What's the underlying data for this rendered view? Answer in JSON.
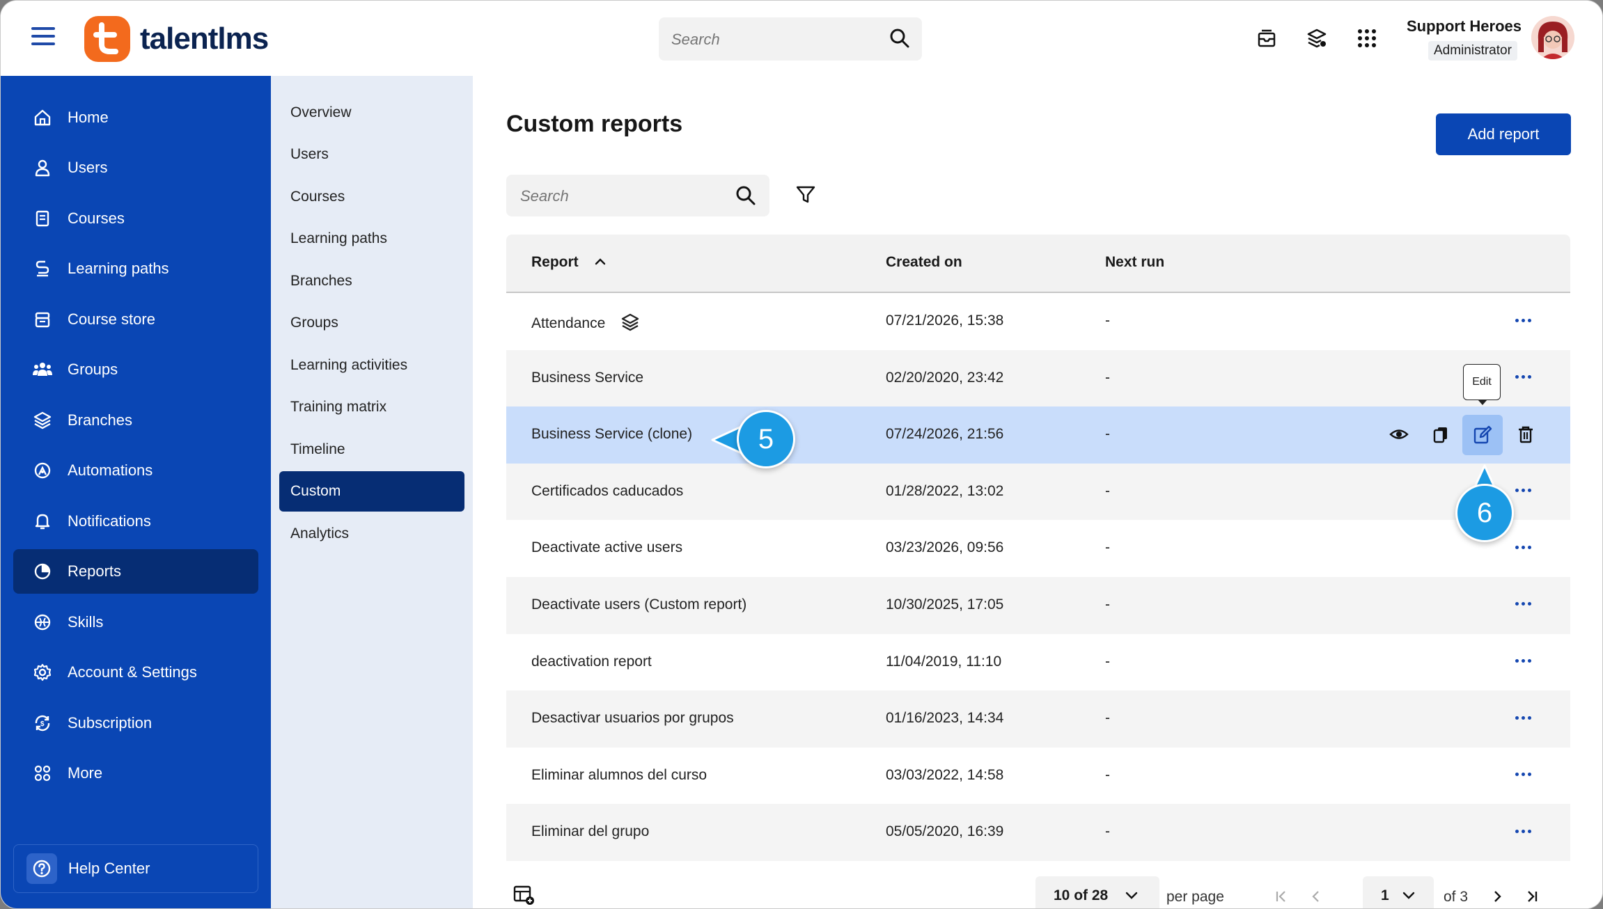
{
  "app": {
    "logo_text": "talentlms",
    "search_placeholder": "Search"
  },
  "user": {
    "name": "Support Heroes",
    "role": "Administrator"
  },
  "sidebar": {
    "items": [
      {
        "label": "Home"
      },
      {
        "label": "Users"
      },
      {
        "label": "Courses"
      },
      {
        "label": "Learning paths"
      },
      {
        "label": "Course store"
      },
      {
        "label": "Groups"
      },
      {
        "label": "Branches"
      },
      {
        "label": "Automations"
      },
      {
        "label": "Notifications"
      },
      {
        "label": "Reports"
      },
      {
        "label": "Skills"
      },
      {
        "label": "Account & Settings"
      },
      {
        "label": "Subscription"
      },
      {
        "label": "More"
      }
    ],
    "help_label": "Help Center"
  },
  "subnav": {
    "items": [
      {
        "label": "Overview"
      },
      {
        "label": "Users"
      },
      {
        "label": "Courses"
      },
      {
        "label": "Learning paths"
      },
      {
        "label": "Branches"
      },
      {
        "label": "Groups"
      },
      {
        "label": "Learning activities"
      },
      {
        "label": "Training matrix"
      },
      {
        "label": "Timeline"
      },
      {
        "label": "Custom"
      },
      {
        "label": "Analytics"
      }
    ]
  },
  "main": {
    "title": "Custom reports",
    "add_button": "Add report",
    "search_placeholder": "Search",
    "columns": {
      "report": "Report",
      "created_on": "Created on",
      "next_run": "Next run"
    },
    "rows": [
      {
        "report": "Attendance",
        "created_on": "07/21/2026, 15:38",
        "next_run": "-"
      },
      {
        "report": "Business Service",
        "created_on": "02/20/2020, 23:42",
        "next_run": "-"
      },
      {
        "report": "Business Service (clone)",
        "created_on": "07/24/2026, 21:56",
        "next_run": "-"
      },
      {
        "report": "Certificados caducados",
        "created_on": "01/28/2022, 13:02",
        "next_run": "-"
      },
      {
        "report": "Deactivate active users",
        "created_on": "03/23/2026, 09:56",
        "next_run": "-"
      },
      {
        "report": "Deactivate users (Custom report)",
        "created_on": "10/30/2025, 17:05",
        "next_run": "-"
      },
      {
        "report": "deactivation report",
        "created_on": "11/04/2019, 11:10",
        "next_run": "-"
      },
      {
        "report": "Desactivar usuarios por grupos",
        "created_on": "01/16/2023, 14:34",
        "next_run": "-"
      },
      {
        "report": "Eliminar alumnos del curso",
        "created_on": "03/03/2022, 14:58",
        "next_run": "-"
      },
      {
        "report": "Eliminar del grupo",
        "created_on": "05/05/2020, 16:39",
        "next_run": "-"
      }
    ],
    "tooltip": "Edit",
    "callouts": {
      "a": "5",
      "b": "6"
    }
  },
  "pagination": {
    "per_page_value": "10 of 28",
    "per_page_label": "per page",
    "page_value": "1",
    "of_pages": "of 3"
  },
  "colors": {
    "sidebar": "#0a46b4",
    "active": "#062d74",
    "accent": "#1c9be3",
    "selected_row": "#c9ddfb",
    "logo": "#f36a1d"
  }
}
